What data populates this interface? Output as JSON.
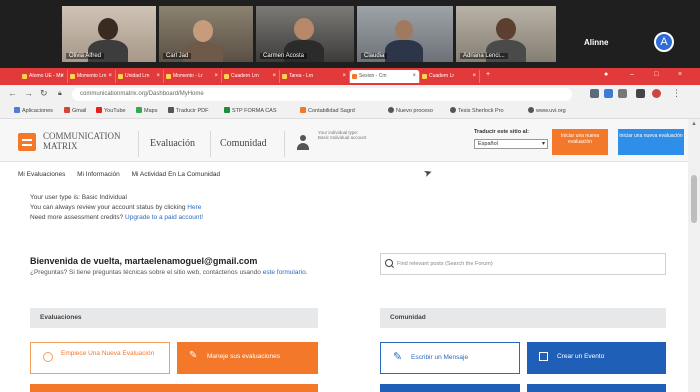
{
  "video_call": {
    "participants": [
      {
        "name": "Olivia Alfred"
      },
      {
        "name": "Carl Jad"
      },
      {
        "name": "Carmen Acosta"
      },
      {
        "name": "Claudia"
      },
      {
        "name": "Adriana Lenci..."
      }
    ],
    "self_name": "Alinne",
    "self_initial": "A"
  },
  "browser": {
    "tabs": [
      {
        "label": "Atomo UE - Ms"
      },
      {
        "label": "Momento Lrn"
      },
      {
        "label": "Unidad Lrn"
      },
      {
        "label": "Momento - Lr"
      },
      {
        "label": "Cuadern Lrn"
      },
      {
        "label": "Tarea - Lrn"
      },
      {
        "label": "Sesion - Cm"
      },
      {
        "label": "Cuadern Lr"
      }
    ],
    "url": "communicationmatrix.org/Dashboard/MyHome",
    "bookmarks": [
      {
        "label": "Aplicaciones"
      },
      {
        "label": "Gmail"
      },
      {
        "label": "YouTube"
      },
      {
        "label": "Maps"
      },
      {
        "label": "Traducir PDF"
      },
      {
        "label": "STP FORMA CAS"
      },
      {
        "label": "Contabilidad Sagrd"
      },
      {
        "label": "Nuevo proceso"
      },
      {
        "label": "Tesis Sherlock Pro"
      },
      {
        "label": "www.uvi.org"
      }
    ]
  },
  "header": {
    "logo_line1": "COMMUNICATION",
    "logo_line2": "MATRIX",
    "nav": [
      "Evaluación",
      "Comunidad"
    ],
    "user_info": "Your individual type: Basic Individual account",
    "language_label": "Traducir este sitio al:",
    "language_selected": "Español",
    "btn_orange": "Iniciar una nueva evaluación",
    "btn_blue": "Iniciar una nueva evaluación"
  },
  "subnav": [
    "Mi Evaluaciones",
    "Mi Información",
    "Mi Actividad En La Comunidad"
  ],
  "notice": {
    "line1": "Your user type is: Basic Individual",
    "line2_prefix": "You can always review your account status by clicking ",
    "line2_link": "Here",
    "line3_prefix": "Need more assessment credits? ",
    "line3_link": "Upgrade to a paid account!"
  },
  "welcome": {
    "title": "Bienvenida de vuelta, martaelenamoguel@gmail.com",
    "body_prefix": "¿Preguntas? Si tiene preguntas técnicas sobre el sitio web, contáctenos usando ",
    "body_link": "este formulario",
    "body_suffix": "."
  },
  "search": {
    "placeholder": "Find relevant posts (Search the Forum)"
  },
  "sections": {
    "left": "Evaluaciones",
    "right": "Comunidad"
  },
  "actions": {
    "new_eval": "Empiece Una Nueva Evaluación",
    "manage_evals": "Maneje sus evaluaciones",
    "write_message": "Escribir un Mensaje",
    "create_event": "Crear un Evento"
  },
  "colors": {
    "accent_orange": "#f4782a",
    "accent_blue": "#1f5fb8",
    "tabbar_red": "#e23a3a"
  }
}
